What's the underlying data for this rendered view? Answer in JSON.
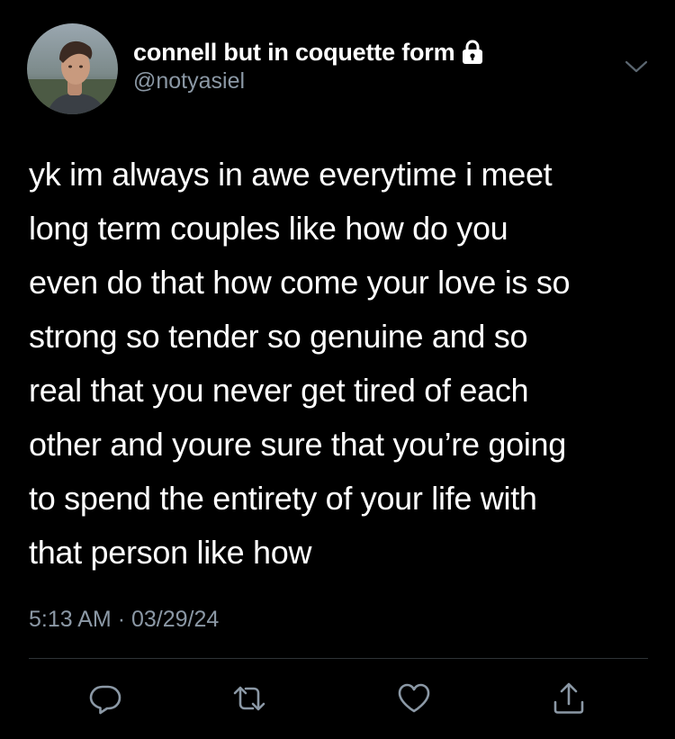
{
  "author": {
    "display_name": "connell but in coquette form",
    "handle": "@notyasiel",
    "protected_icon": "lock-icon",
    "avatar": "profile-photo"
  },
  "menu_icon": "chevron-down-icon",
  "tweet": {
    "lines": [
      "yk im always in awe everytime i meet",
      "long term couples like how do you",
      "even do that how come your love is so",
      "strong so tender so genuine and so",
      "real that you never get tired of each",
      "other and youre sure that you’re going",
      "to spend the entirety of your life with",
      "that person like how"
    ],
    "time": "5:13 AM",
    "separator": "·",
    "date": "03/29/24"
  },
  "actions": {
    "reply_icon": "reply-icon",
    "retweet_icon": "retweet-icon",
    "like_icon": "heart-icon",
    "share_icon": "share-icon"
  },
  "colors": {
    "background": "#000000",
    "text": "#ffffff",
    "secondary": "#8b98a5",
    "divider": "#2f3336"
  }
}
